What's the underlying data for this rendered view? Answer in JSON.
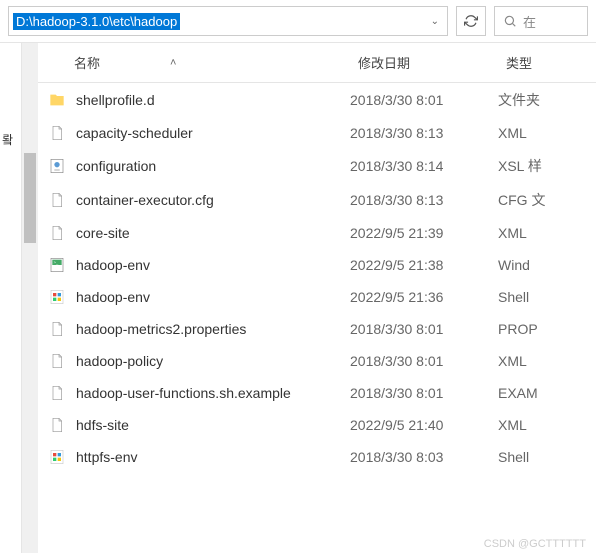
{
  "toolbar": {
    "path": "D:\\hadoop-3.1.0\\etc\\hadoop",
    "search_placeholder": "在"
  },
  "columns": {
    "name": "名称",
    "date": "修改日期",
    "type": "类型"
  },
  "left_label": "뢐",
  "files": [
    {
      "icon": "folder",
      "name": "shellprofile.d",
      "date": "2018/3/30 8:01",
      "type": "文件夹"
    },
    {
      "icon": "file",
      "name": "capacity-scheduler",
      "date": "2018/3/30 8:13",
      "type": "XML"
    },
    {
      "icon": "xsl",
      "name": "configuration",
      "date": "2018/3/30 8:14",
      "type": "XSL 样"
    },
    {
      "icon": "file",
      "name": "container-executor.cfg",
      "date": "2018/3/30 8:13",
      "type": "CFG 文"
    },
    {
      "icon": "file",
      "name": "core-site",
      "date": "2022/9/5 21:39",
      "type": "XML"
    },
    {
      "icon": "cmd",
      "name": "hadoop-env",
      "date": "2022/9/5 21:38",
      "type": "Wind"
    },
    {
      "icon": "sh",
      "name": "hadoop-env",
      "date": "2022/9/5 21:36",
      "type": "Shell"
    },
    {
      "icon": "file",
      "name": "hadoop-metrics2.properties",
      "date": "2018/3/30 8:01",
      "type": "PROP"
    },
    {
      "icon": "file",
      "name": "hadoop-policy",
      "date": "2018/3/30 8:01",
      "type": "XML"
    },
    {
      "icon": "file",
      "name": "hadoop-user-functions.sh.example",
      "date": "2018/3/30 8:01",
      "type": "EXAM"
    },
    {
      "icon": "file",
      "name": "hdfs-site",
      "date": "2022/9/5 21:40",
      "type": "XML"
    },
    {
      "icon": "sh",
      "name": "httpfs-env",
      "date": "2018/3/30 8:03",
      "type": "Shell"
    }
  ],
  "watermark": "CSDN @GCTTTTTT"
}
